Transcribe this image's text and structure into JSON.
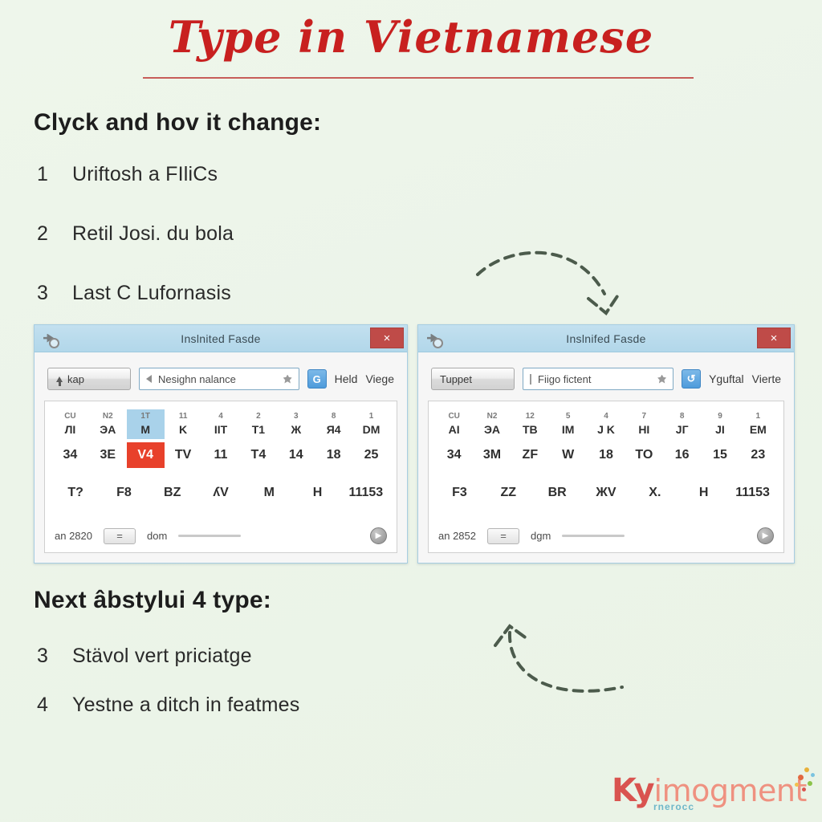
{
  "page": {
    "background_color": "#edf5ea",
    "title": "Type in Vietnamese",
    "title_color": "#c8201f"
  },
  "sections": {
    "top": {
      "heading": "Clyck and hov it change:",
      "items": [
        {
          "num": "1",
          "text": "Uriftosh a FIliCs"
        },
        {
          "num": "2",
          "text": "Retil Josi. du bola"
        },
        {
          "num": "3",
          "text": "Last C Lufornasis"
        }
      ]
    },
    "bottom": {
      "heading": "Next âbstylui 4 type:",
      "items": [
        {
          "num": "3",
          "text": "Stävol vert priciatge"
        },
        {
          "num": "4",
          "text": "Yestne a ditch in featmes"
        }
      ]
    }
  },
  "windows": [
    {
      "id": "window-left",
      "title": "Inslnited Fasde",
      "sysicon": "app-icon",
      "close_label": "×",
      "close_color": "#bf4b48",
      "titlebar_color": "#b9dbec",
      "toolbar": {
        "button_label": "kap",
        "button_icon": "up-arrow-icon",
        "input_value": "Nesighn nalance",
        "input_left_icon": "caret-left-icon",
        "input_right_icon": "star-blob-icon",
        "badge_label": "G",
        "badge_color": "#4e9bdb",
        "link1": "Held",
        "link2": "Viege"
      },
      "grid": {
        "header": [
          {
            "sup": "CU",
            "main": "ЛI",
            "highlight": false
          },
          {
            "sup": "N2",
            "main": "ЭA",
            "highlight": false
          },
          {
            "sup": "1T",
            "main": "M",
            "highlight": true
          },
          {
            "sup": "11",
            "main": "K",
            "highlight": false
          },
          {
            "sup": "4",
            "main": "IIT",
            "highlight": false
          },
          {
            "sup": "2",
            "main": "T1",
            "highlight": false
          },
          {
            "sup": "3",
            "main": "Ж",
            "highlight": false
          },
          {
            "sup": "8",
            "main": "Я4",
            "highlight": false
          },
          {
            "sup": "1",
            "main": "DM",
            "highlight": false
          }
        ],
        "row2": [
          {
            "v": "34",
            "highlight": false
          },
          {
            "v": "3E",
            "highlight": false
          },
          {
            "v": "V4",
            "highlight": true
          },
          {
            "v": "TV",
            "highlight": false
          },
          {
            "v": "11",
            "highlight": false
          },
          {
            "v": "T4",
            "highlight": false
          },
          {
            "v": "14",
            "highlight": false
          },
          {
            "v": "18",
            "highlight": false
          },
          {
            "v": "25",
            "highlight": false
          }
        ],
        "row3": [
          "T?",
          "F8",
          "BZ",
          "ʎV",
          "M",
          "H",
          "11153"
        ],
        "footer": {
          "left_text": "an 2820",
          "eq_label": "=",
          "mid_text": "dom",
          "circle_icon": "play-circle-icon"
        }
      },
      "highlight_blue": "#a9d2ea",
      "highlight_red": "#e8412b"
    },
    {
      "id": "window-right",
      "title": "Inslnifed Fasde",
      "sysicon": "app-icon",
      "close_label": "×",
      "close_color": "#bf4b48",
      "titlebar_color": "#b9dbec",
      "toolbar": {
        "button_label": "Tuppet",
        "button_icon": "",
        "input_value": "Fiigo fictent",
        "input_left_icon": "bar-left-icon",
        "input_right_icon": "star-blob-icon",
        "badge_label": "↺",
        "badge_color": "#4e9bdb",
        "link1": "Yguftal",
        "link2": "Vierte"
      },
      "grid": {
        "header": [
          {
            "sup": "CU",
            "main": "AI",
            "highlight": false
          },
          {
            "sup": "N2",
            "main": "ЭA",
            "highlight": false
          },
          {
            "sup": "12",
            "main": "TB",
            "highlight": false
          },
          {
            "sup": "5",
            "main": "IM",
            "highlight": false
          },
          {
            "sup": "4",
            "main": "J K",
            "highlight": false
          },
          {
            "sup": "7",
            "main": "HI",
            "highlight": false
          },
          {
            "sup": "8",
            "main": "JГ",
            "highlight": false
          },
          {
            "sup": "9",
            "main": "JI",
            "highlight": false
          },
          {
            "sup": "1",
            "main": "EM",
            "highlight": false
          }
        ],
        "row2": [
          {
            "v": "34",
            "highlight": false
          },
          {
            "v": "3M",
            "highlight": false
          },
          {
            "v": "ZF",
            "highlight": false
          },
          {
            "v": "W",
            "highlight": false
          },
          {
            "v": "18",
            "highlight": false
          },
          {
            "v": "TO",
            "highlight": false
          },
          {
            "v": "16",
            "highlight": false
          },
          {
            "v": "15",
            "highlight": false
          },
          {
            "v": "23",
            "highlight": false
          }
        ],
        "row3": [
          "F3",
          "ZZ",
          "BR",
          "ЖV",
          "X.",
          "H",
          "11153"
        ],
        "footer": {
          "left_text": "an 2852",
          "eq_label": "=",
          "mid_text": "dgm",
          "circle_icon": "play-circle-icon"
        }
      }
    }
  ],
  "arrows": [
    {
      "name": "arrow-top-curved",
      "direction": "down-right",
      "style": "dashed"
    },
    {
      "name": "arrow-bottom-curved",
      "direction": "up-left",
      "style": "dashed"
    }
  ],
  "logo": {
    "prefix": "Ky",
    "suffix": "imogment",
    "subtitle": "rnerocc",
    "prefix_color": "#d9534f",
    "suffix_color": "#ef9180",
    "dot_colors": [
      "#e8b13a",
      "#7bc4e0",
      "#e2683f",
      "#8bc34a",
      "#f2c14e",
      "#d9534f"
    ]
  }
}
